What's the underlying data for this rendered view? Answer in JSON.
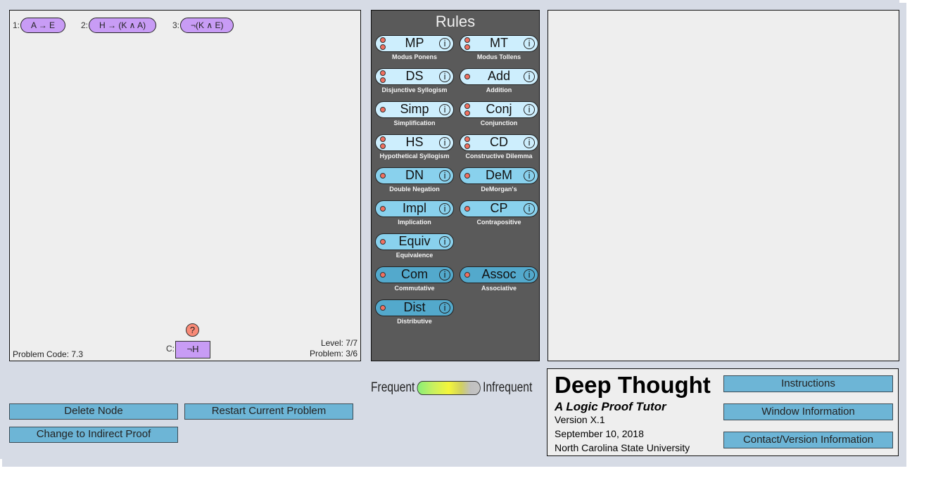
{
  "proof": {
    "premises": [
      {
        "num": "1:",
        "formula": "A → E"
      },
      {
        "num": "2:",
        "formula": "H → (K ∧ A)"
      },
      {
        "num": "3:",
        "formula": "¬(K ∧ E)"
      }
    ],
    "help_icon": "?",
    "conclusion_label": "C:",
    "conclusion": "¬H",
    "problem_code": "Problem Code: 7.3",
    "level": "Level: 7/7",
    "problem": "Problem: 3/6"
  },
  "rules": {
    "title": "Rules",
    "info_glyph": "i",
    "items": [
      {
        "abbr": "MP",
        "name": "Modus Ponens",
        "inputs": 2,
        "tier": 1
      },
      {
        "abbr": "MT",
        "name": "Modus Tollens",
        "inputs": 2,
        "tier": 1
      },
      {
        "abbr": "DS",
        "name": "Disjunctive Syllogism",
        "inputs": 2,
        "tier": 1
      },
      {
        "abbr": "Add",
        "name": "Addition",
        "inputs": 1,
        "tier": 1
      },
      {
        "abbr": "Simp",
        "name": "Simplification",
        "inputs": 1,
        "tier": 1
      },
      {
        "abbr": "Conj",
        "name": "Conjunction",
        "inputs": 2,
        "tier": 1
      },
      {
        "abbr": "HS",
        "name": "Hypothetical Syllogism",
        "inputs": 2,
        "tier": 1
      },
      {
        "abbr": "CD",
        "name": "Constructive Dilemma",
        "inputs": 2,
        "tier": 1
      },
      {
        "abbr": "DN",
        "name": "Double Negation",
        "inputs": 1,
        "tier": 2
      },
      {
        "abbr": "DeM",
        "name": "DeMorgan's",
        "inputs": 1,
        "tier": 2
      },
      {
        "abbr": "Impl",
        "name": "Implication",
        "inputs": 1,
        "tier": 2
      },
      {
        "abbr": "CP",
        "name": "Contrapositive",
        "inputs": 1,
        "tier": 2
      },
      {
        "abbr": "Equiv",
        "name": "Equivalence",
        "inputs": 1,
        "tier": 2
      },
      {
        "abbr": "Com",
        "name": "Commutative",
        "inputs": 1,
        "tier": 3
      },
      {
        "abbr": "Assoc",
        "name": "Associative",
        "inputs": 1,
        "tier": 3
      },
      {
        "abbr": "Dist",
        "name": "Distributive",
        "inputs": 1,
        "tier": 3
      }
    ]
  },
  "legend": {
    "left": "Frequent",
    "right": "Infrequent"
  },
  "actions": {
    "delete_node": "Delete Node",
    "restart": "Restart Current Problem",
    "indirect": "Change to Indirect Proof"
  },
  "about": {
    "title": "Deep Thought",
    "subtitle": "A Logic Proof Tutor",
    "version": "Version X.1",
    "date": "September 10, 2018",
    "org": "North Carolina State University",
    "instructions": "Instructions",
    "window_info": "Window Information",
    "contact": "Contact/Version Information"
  }
}
